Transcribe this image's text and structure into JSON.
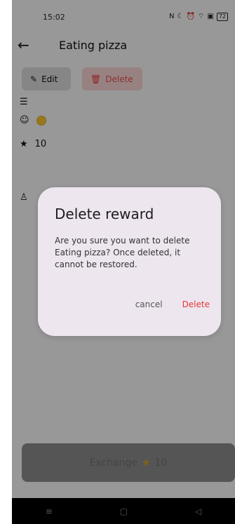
{
  "status": {
    "time": "15:02",
    "battery": "72"
  },
  "appbar": {
    "title": "Eating pizza"
  },
  "actions": {
    "edit_label": "Edit",
    "delete_label": "Delete"
  },
  "details": {
    "points": "10"
  },
  "dialog": {
    "title": "Delete reward",
    "message": "Are you sure you want to delete Eating pizza? Once deleted, it cannot be restored.",
    "cancel": "cancel",
    "confirm": "Delete"
  },
  "exchange": {
    "label": "Exchange",
    "cost": "10"
  },
  "colors": {
    "danger": "#e53935",
    "dialog_bg": "#ede6ef"
  }
}
